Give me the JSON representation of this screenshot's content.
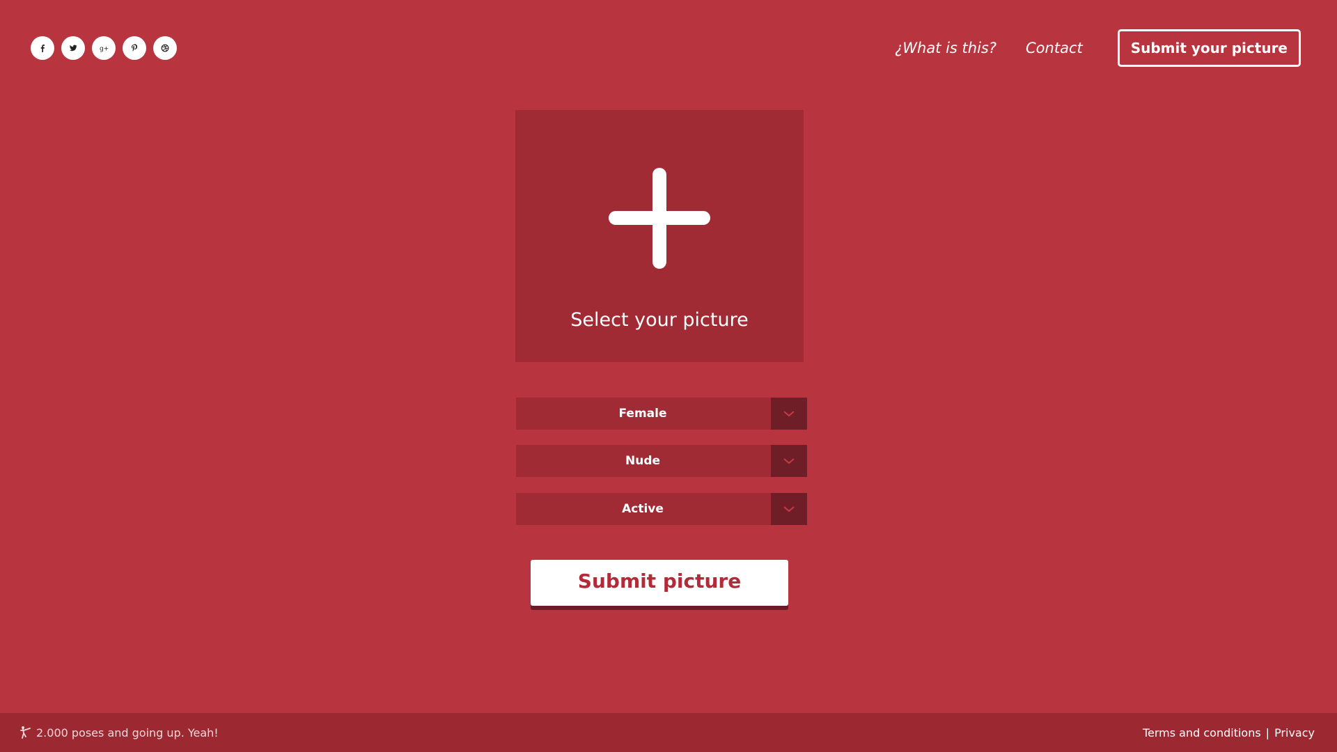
{
  "social": [
    {
      "name": "facebook-icon",
      "glyph": "f"
    },
    {
      "name": "twitter-icon",
      "glyph": "t"
    },
    {
      "name": "google-plus-icon",
      "glyph": "g+"
    },
    {
      "name": "pinterest-icon",
      "glyph": "p"
    },
    {
      "name": "dribbble-icon",
      "glyph": "d"
    }
  ],
  "nav": {
    "what_label": "¿What is this?",
    "contact_label": "Contact",
    "submit_label": "Submit your picture"
  },
  "picker": {
    "icon": "plus-icon",
    "label": "Select your picture"
  },
  "selects": [
    {
      "value": "Female"
    },
    {
      "value": "Nude"
    },
    {
      "value": "Active"
    }
  ],
  "submit_label": "Submit picture",
  "footer": {
    "tagline": "2.000 poses and going up. Yeah!",
    "terms_label": "Terms and conditions",
    "separator": "|",
    "privacy_label": "Privacy"
  },
  "colors": {
    "background": "#b8343f",
    "panel": "#a02b34",
    "arrow_bg": "#6f1e28",
    "accent_text": "#b12b39",
    "white": "#ffffff"
  }
}
